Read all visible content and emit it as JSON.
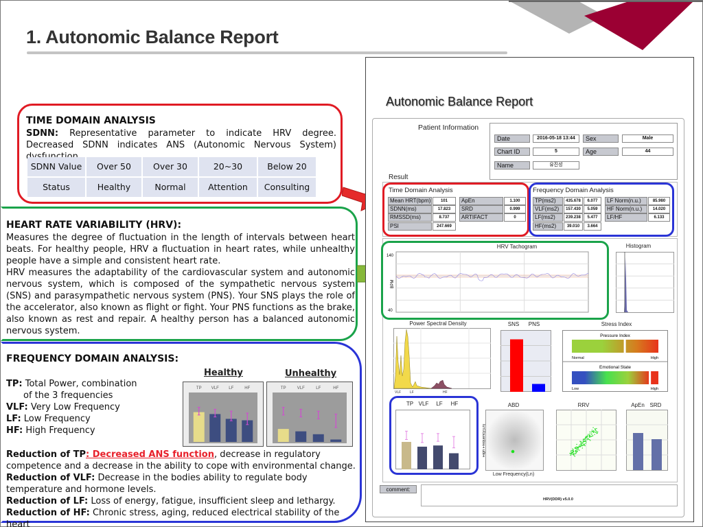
{
  "header": {
    "title": "1. Autonomic Balance Report"
  },
  "time_domain": {
    "title": "TIME DOMAIN ANALYSIS",
    "sdnn_label": "SDNN:",
    "sdnn_text": " Representative parameter to indicate HRV degree. Decreased SDNN indicates ANS (Autonomic Nervous System) dysfunction.",
    "table": {
      "row1": [
        "SDNN Value",
        "Over 50",
        "Over 30",
        "20~30",
        "Below 20"
      ],
      "row2": [
        "Status",
        "Healthy",
        "Normal",
        "Attention",
        "Consulting"
      ]
    }
  },
  "hrv": {
    "title": "HEART RATE VARIABILITY (HRV):",
    "para1": "Measures the degree of fluctuation in the length of intervals between heart beats. For healthy people, HRV a fluctuation in heart rates, while unhealthy people have a simple and consistent heart rate.",
    "para2": "HRV measures the adaptability of the cardiovascular system and autonomic nervous system, which is composed of the sympathetic nervous system (SNS) and parasympathetic nervous system (PNS). Your SNS plays the role of the accelerator, also known as flight or fight. Your PNS functions as the brake, also known as rest and repair. A healthy person has a balanced autonomic nervous system."
  },
  "frequency": {
    "title": "FREQUENCY DOMAIN ANALYSIS:",
    "defs": [
      {
        "term": "TP:",
        "text": " Total Power, combination"
      },
      {
        "term": "",
        "text": "of the 3 frequencies"
      },
      {
        "term": "VLF:",
        "text": " Very Low Frequency"
      },
      {
        "term": "LF:",
        "text": " Low Frequency"
      },
      {
        "term": "HF:",
        "text": " High Frequency"
      }
    ],
    "healthy_label": "Healthy",
    "unhealthy_label": "Unhealthy",
    "bar_labels": [
      "TP",
      "VLF",
      "LF",
      "HF"
    ],
    "reductions": [
      {
        "term": "Reduction of TP",
        "highlight": ": Decreased ANS function",
        "text": ", decrease in regulatory competence and a decrease in the ability to cope with environmental change."
      },
      {
        "term": "Reduction of VLF:",
        "highlight": "",
        "text": " Decrease in the bodies ability to regulate body temperature and hormone levels."
      },
      {
        "term": "Reduction of LF:",
        "highlight": "",
        "text": " Loss of energy, fatigue, insufficient sleep and lethargy."
      },
      {
        "term": "Reduction of HF:",
        "highlight": "",
        "text": " Chronic stress, aging, reduced electrical stability of the heart"
      }
    ]
  },
  "report": {
    "title": "Autonomic Balance Report",
    "patient_info_label": "Patient Information",
    "patient": {
      "date_label": "Date",
      "date": "2016-05-18 13:44",
      "sex_label": "Sex",
      "sex": "Male",
      "chart_id_label": "Chart ID",
      "chart_id": "5",
      "age_label": "Age",
      "age": "44",
      "name_label": "Name",
      "name": "유진성"
    },
    "result_label": "Result",
    "time_domain": {
      "title": "Time Domain Analysis",
      "rows": [
        {
          "label": "Mean HRT(bpm)",
          "value": "101"
        },
        {
          "label": "SDNN(ms)",
          "value": "17.823"
        },
        {
          "label": "RMSSD(ms)",
          "value": "8.737"
        },
        {
          "label": "PSI",
          "value": "247.669"
        }
      ],
      "rows_right": [
        {
          "label": "ApEn",
          "value": "1.100"
        },
        {
          "label": "SRD",
          "value": "0.999"
        },
        {
          "label": "ARTIFACT",
          "value": "0"
        }
      ]
    },
    "freq_domain": {
      "title": "Frequency Domain Analysis",
      "rows": [
        {
          "label": "TP(ms2)",
          "v1": "435.678",
          "v2": "6.077"
        },
        {
          "label": "VLF(ms2)",
          "v1": "157.430",
          "v2": "5.059"
        },
        {
          "label": "LF(ms2)",
          "v1": "239.238",
          "v2": "5.477"
        },
        {
          "label": "HF(ms2)",
          "v1": "39.010",
          "v2": "3.664"
        }
      ],
      "rows_right": [
        {
          "label": "LF Norm(n.u.)",
          "value": "85.980"
        },
        {
          "label": "HF Norm(n.u.)",
          "value": "14.020"
        },
        {
          "label": "LF/HF",
          "value": "6.133"
        }
      ]
    },
    "tachogram": {
      "title": "HRV Tachogram",
      "ylabel": "BPM",
      "ymax": "140",
      "ymin": "40"
    },
    "histogram": {
      "title": "Histogram"
    },
    "psd": {
      "title": "Power Spectral Density",
      "xlabels": [
        "VLF",
        "LF",
        "HF"
      ]
    },
    "sns_pns": {
      "labels": [
        "SNS",
        "PNS"
      ],
      "sns_fraction": 0.85,
      "pns_fraction": 0.15
    },
    "stress": {
      "title": "Stress Index",
      "pressure_title": "Pressure Index",
      "pressure_low": "Normal",
      "pressure_high": "High",
      "pressure_level": 0.6,
      "emotional_title": "Emotional State",
      "emotional_low": "Low",
      "emotional_high": "High",
      "emotional_level": 0.89
    },
    "balance_labels": [
      "TP",
      "VLF",
      "LF",
      "HF"
    ],
    "abd": {
      "title": "ABD",
      "xlabel": "Low Frequency(Ln)",
      "ylabel": "High Frequency(Ln)"
    },
    "rrv": {
      "title": "RRV"
    },
    "apen_srd": {
      "labels": [
        "ApEn",
        "SRD"
      ]
    },
    "comment_label": "comment:",
    "version": "HRV(DDR) v5.0.0"
  }
}
